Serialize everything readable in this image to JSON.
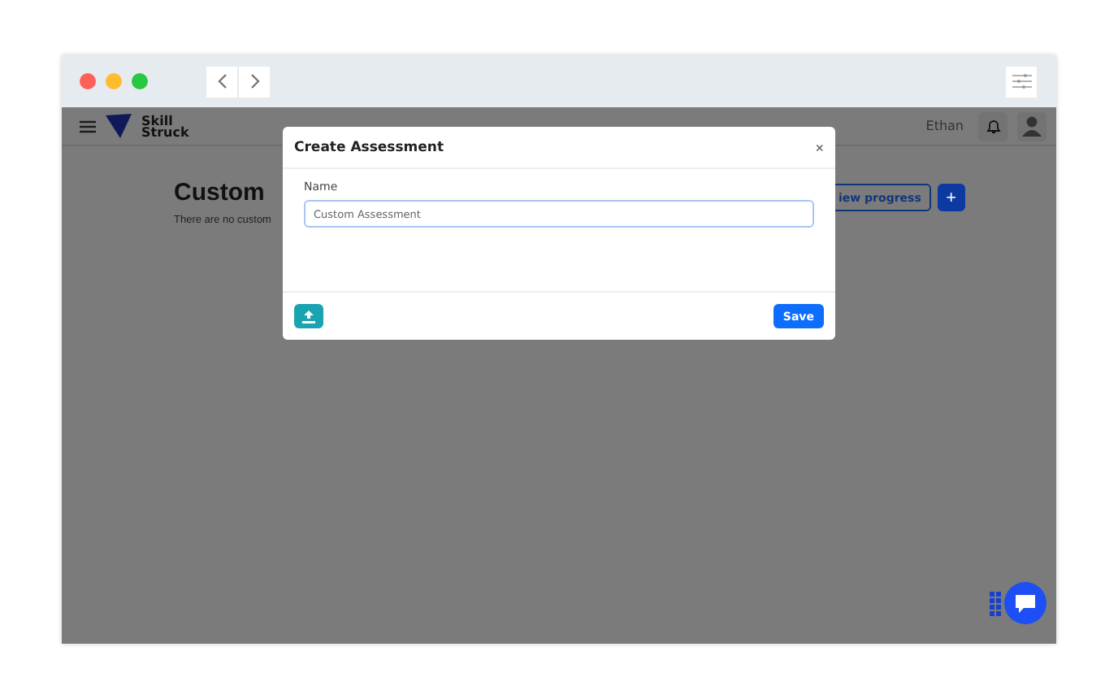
{
  "browser": {
    "traffic_lights": [
      {
        "color": "#fe5f57"
      },
      {
        "color": "#febc2e"
      },
      {
        "color": "#28c840"
      }
    ]
  },
  "app_header": {
    "logo_lines": [
      "Skill",
      "Struck"
    ],
    "user_name": "Ethan"
  },
  "page": {
    "heading": "Custom",
    "empty_message": "There are no custom",
    "view_progress_button": "iew progress",
    "add_button": "+"
  },
  "modal": {
    "title": "Create Assessment",
    "close": "×",
    "field_label": "Name",
    "field_value": "Custom Assessment",
    "save_button": "Save"
  }
}
